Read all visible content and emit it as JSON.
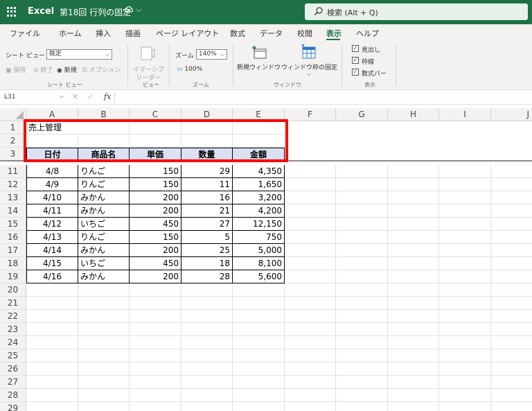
{
  "titlebar": {
    "app_name": "Excel",
    "doc_title": "第18回 行列の固定",
    "status_icon": "cloud-sync-icon",
    "chevron": "⌵",
    "search_placeholder": "検索 (Alt + Q)",
    "accent": "#1e7145"
  },
  "menu": {
    "tabs": [
      {
        "label": "ファイル"
      },
      {
        "label": "ホーム"
      },
      {
        "label": "挿入"
      },
      {
        "label": "描画"
      },
      {
        "label": "ページ レイアウト"
      },
      {
        "label": "数式"
      },
      {
        "label": "データ"
      },
      {
        "label": "校閲"
      },
      {
        "label": "表示",
        "active": true
      },
      {
        "label": "ヘルプ"
      }
    ]
  },
  "ribbon": {
    "sheetview_label": "シート ビュー",
    "sheetview_value": "既定",
    "keep_label": "保持",
    "exit_label": "終了",
    "new_label": "新規",
    "options_label": "オプション",
    "group_sheetview": "シート ビュー",
    "immersive_line1": "イマーシブ",
    "immersive_line2": "リーダー",
    "group_view": "ビュー",
    "zoom_label": "ズーム",
    "zoom_value": "140%",
    "zoom100_label": "100%",
    "group_zoom": "ズーム",
    "new_window_label": "新規ウィンドウ",
    "freeze_label": "ウィンドウ枠の固定",
    "group_window": "ウィンドウ",
    "headings_label": "見出し",
    "gridlines_label": "枠線",
    "formulabar_label": "数式バー",
    "group_show": "表示"
  },
  "formula_bar": {
    "name_box": "L31",
    "fx": "fx",
    "cancel_glyph": "✕",
    "enter_glyph": "✓"
  },
  "sheet": {
    "columns": [
      "A",
      "B",
      "C",
      "D",
      "E",
      "F",
      "G",
      "H",
      "I",
      "J"
    ],
    "title": "売上管理",
    "headers": [
      "日付",
      "商品名",
      "単価",
      "数量",
      "金額"
    ],
    "row_numbers_top": [
      "1",
      "2",
      "3"
    ],
    "row_numbers_bottom": [
      "11",
      "12",
      "13",
      "14",
      "15",
      "16",
      "17",
      "18",
      "19",
      "20",
      "21",
      "22",
      "23",
      "24",
      "25",
      "26",
      "27",
      "28",
      "29"
    ],
    "rows": [
      {
        "date": "4/8",
        "item": "りんご",
        "price": "150",
        "qty": "29",
        "amount": "4,350"
      },
      {
        "date": "4/9",
        "item": "りんご",
        "price": "150",
        "qty": "11",
        "amount": "1,650"
      },
      {
        "date": "4/10",
        "item": "みかん",
        "price": "200",
        "qty": "16",
        "amount": "3,200"
      },
      {
        "date": "4/11",
        "item": "みかん",
        "price": "200",
        "qty": "21",
        "amount": "4,200"
      },
      {
        "date": "4/12",
        "item": "いちご",
        "price": "450",
        "qty": "27",
        "amount": "12,150"
      },
      {
        "date": "4/13",
        "item": "りんご",
        "price": "150",
        "qty": "5",
        "amount": "750"
      },
      {
        "date": "4/14",
        "item": "みかん",
        "price": "200",
        "qty": "25",
        "amount": "5,000"
      },
      {
        "date": "4/15",
        "item": "いちご",
        "price": "450",
        "qty": "18",
        "amount": "8,100"
      },
      {
        "date": "4/16",
        "item": "みかん",
        "price": "200",
        "qty": "28",
        "amount": "5,600"
      }
    ],
    "header_fill": "#d9e1f2",
    "highlight_color": "#ff0000"
  }
}
